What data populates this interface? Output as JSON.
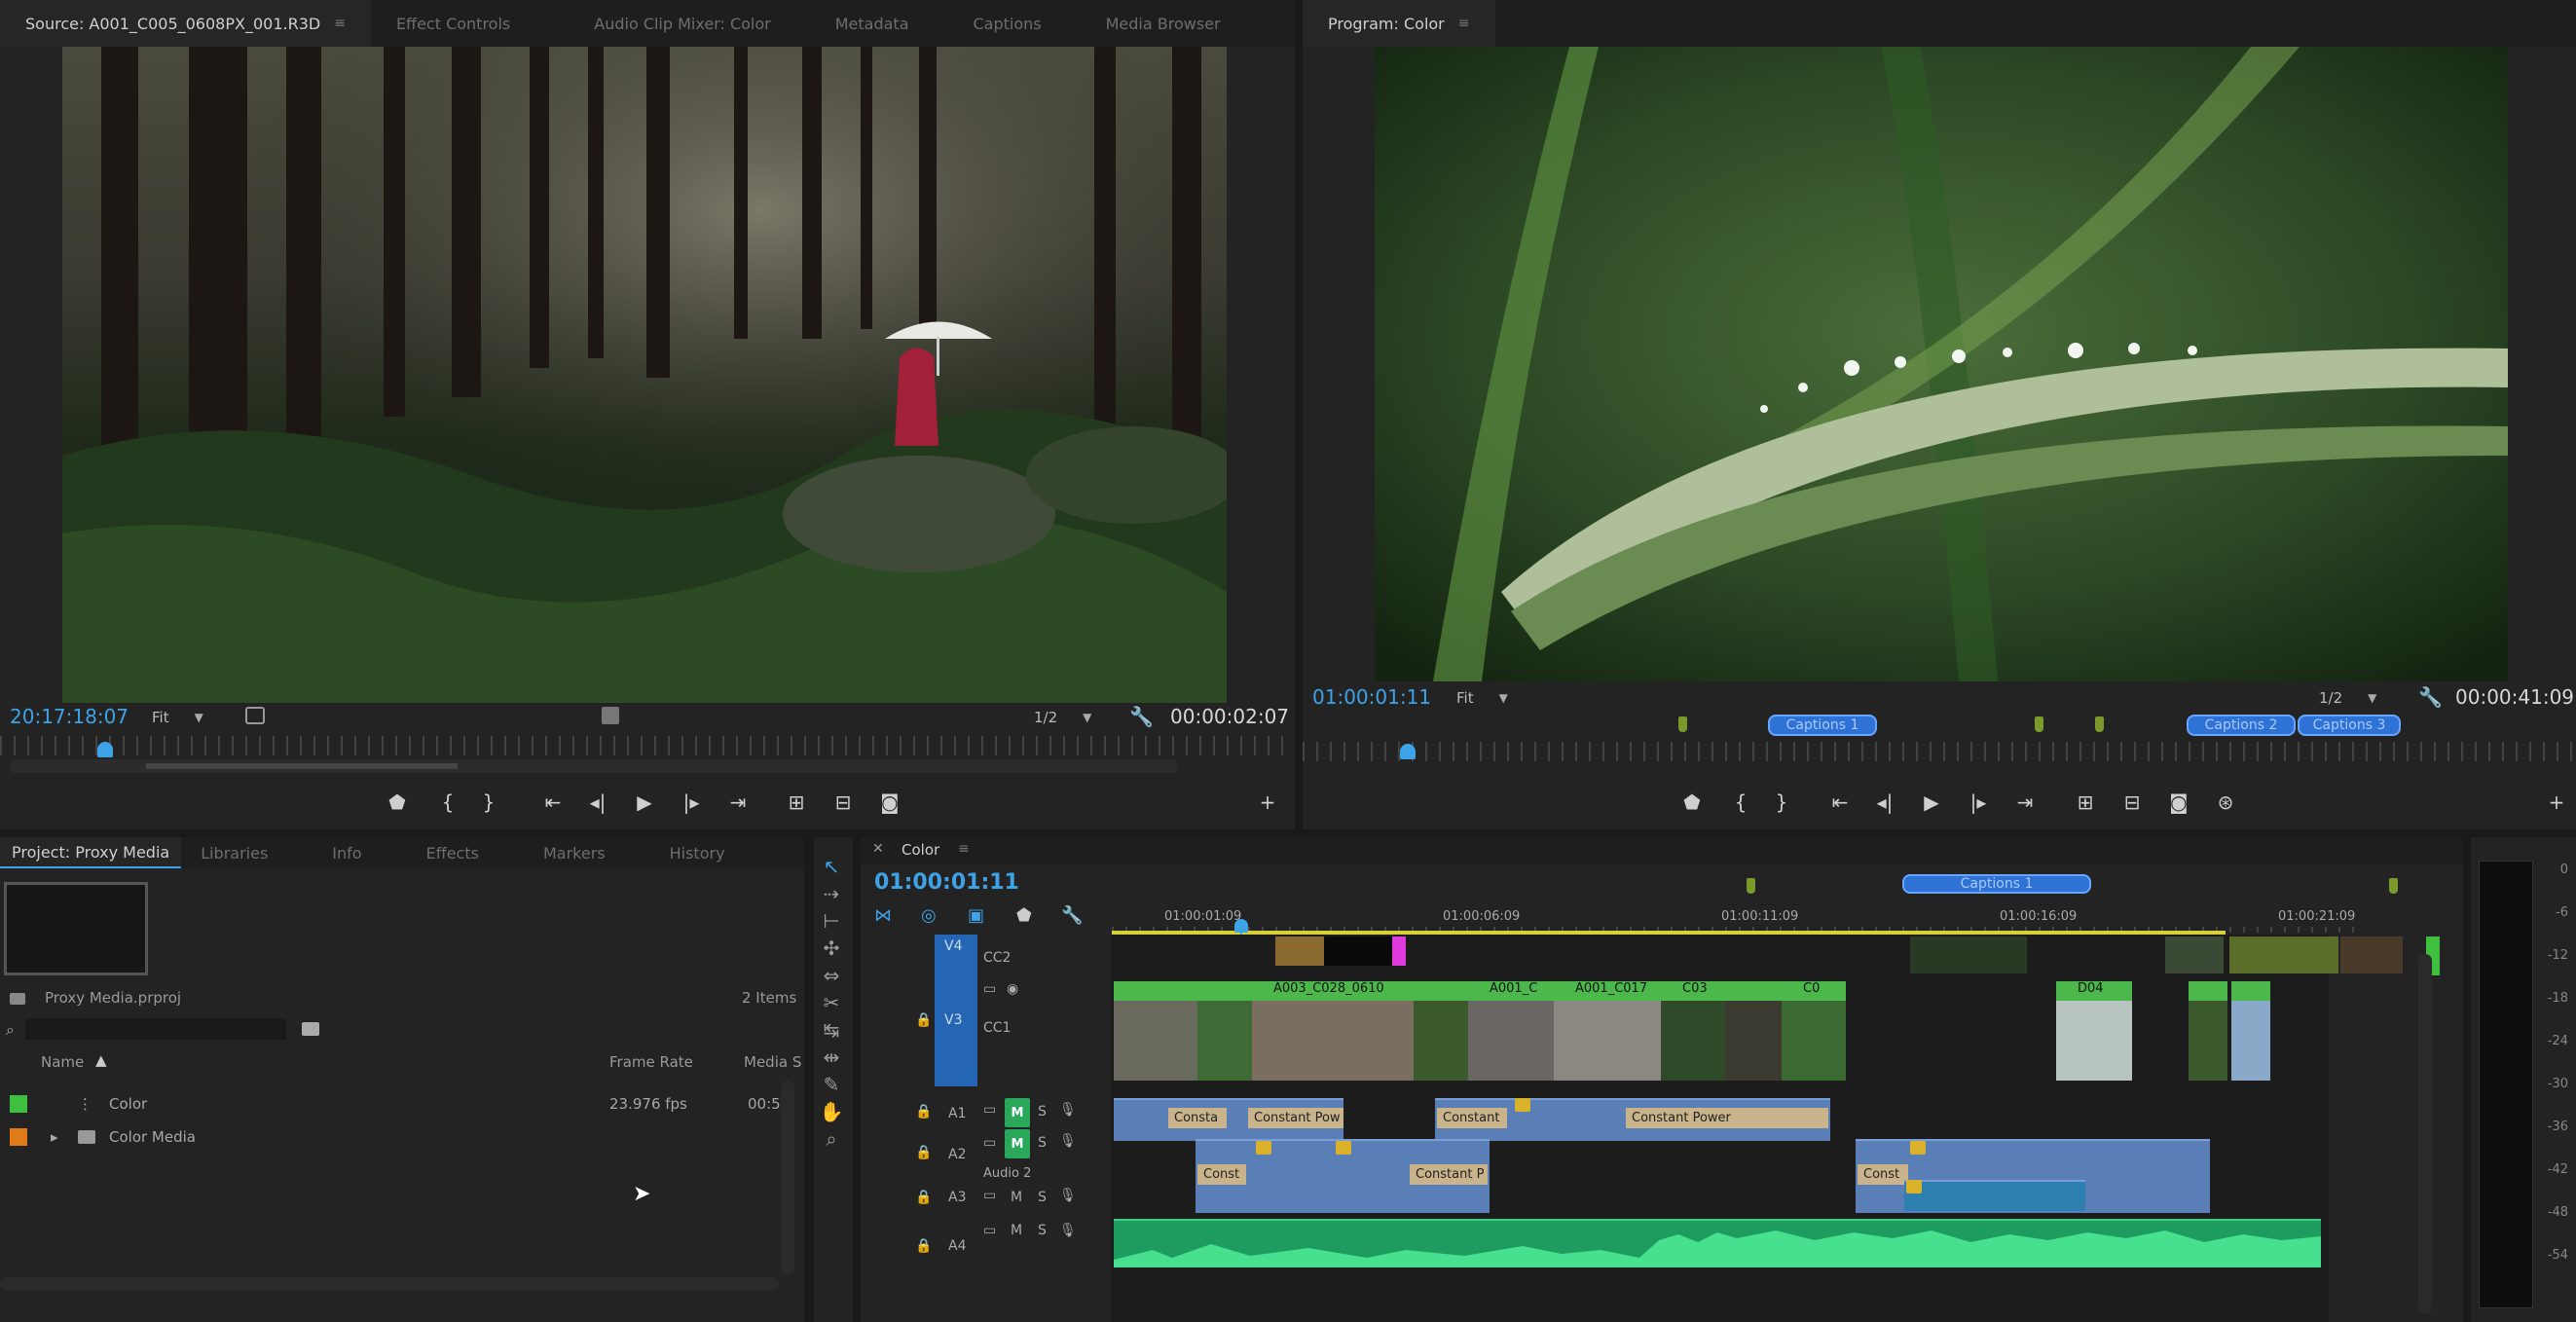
{
  "source_monitor": {
    "tab_title": "Source: A001_C005_0608PX_001.R3D",
    "other_tabs": [
      "Effect Controls",
      "Audio Clip Mixer: Color",
      "Metadata",
      "Captions",
      "Media Browser"
    ],
    "timecode": "20:17:18:07",
    "zoom": "Fit",
    "resolution": "1/2",
    "duration": "00:00:02:07"
  },
  "program_monitor": {
    "tab_title": "Program: Color",
    "timecode": "01:00:01:11",
    "zoom": "Fit",
    "resolution": "1/2",
    "duration": "00:00:41:09",
    "caption_markers": [
      "Captions 1",
      "Captions 2",
      "Captions 3"
    ]
  },
  "transport_icons": [
    "marker-icon",
    "mark-in-icon",
    "mark-out-icon",
    "go-to-in-icon",
    "step-back-icon",
    "play-icon",
    "step-forward-icon",
    "go-to-out-icon",
    "insert-icon",
    "overwrite-icon",
    "export-frame-icon",
    "add-icon"
  ],
  "project_panel": {
    "tabs": [
      "Project: Proxy Media",
      "Libraries",
      "Info",
      "Effects",
      "Markers",
      "History"
    ],
    "project_file": "Proxy Media.prproj",
    "item_count": "2 Items",
    "columns": [
      "Name",
      "Frame Rate",
      "Media S"
    ],
    "rows": [
      {
        "name": "Color",
        "frame_rate": "23.976 fps",
        "media_start": "00:5",
        "label_color": "#3fbf3f"
      },
      {
        "name": "Color Media",
        "frame_rate": "",
        "media_start": "",
        "label_color": "#e07b1a"
      }
    ]
  },
  "timeline": {
    "tab_title": "Color",
    "timecode": "01:00:01:11",
    "ruler": [
      "01:00:01:09",
      "01:00:06:09",
      "01:00:11:09",
      "01:00:16:09",
      "01:00:21:09"
    ],
    "caption_marker": "Captions 1",
    "tracks": {
      "v4": "V4",
      "cc2": "CC2",
      "v3": "V3",
      "cc1": "CC1",
      "a1": "A1",
      "a2": "A2",
      "audio2": "Audio 2",
      "a3": "A3",
      "a4": "A4",
      "m": "M",
      "s": "S"
    },
    "clip_labels": [
      "A003_C028_0610",
      "A001_C",
      "A001_C017",
      "C03",
      "C0",
      "D04"
    ],
    "transitions": [
      "Consta",
      "Constant Pow",
      "Constant",
      "Constant Power",
      "Const",
      "Constant P",
      "Const"
    ]
  },
  "audio_meter": {
    "scale": [
      "0",
      "-6",
      "-12",
      "-18",
      "-24",
      "-30",
      "-36",
      "-42",
      "-48",
      "-54"
    ]
  },
  "colors": {
    "accent_blue": "#3ea2e6",
    "clip_green": "#4cb84c",
    "audio_blue": "#5a7fb7",
    "audio_green": "#1e9b5e",
    "caption_blue": "#2f72d6"
  }
}
